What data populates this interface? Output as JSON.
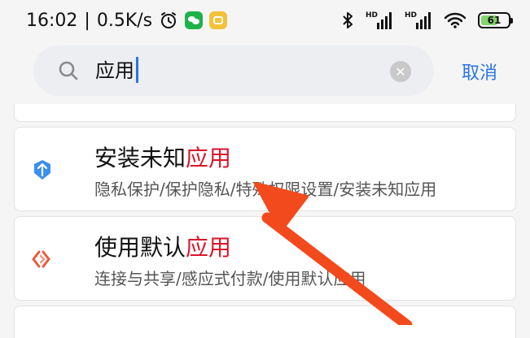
{
  "status_bar": {
    "time": "16:02",
    "separator": "|",
    "network_speed": "0.5K/s",
    "icons": [
      "alarm-icon",
      "wechat-icon",
      "note-app-icon",
      "bluetooth-icon",
      "hd-signal-icon",
      "hd-signal-icon",
      "wifi-icon",
      "battery-icon"
    ],
    "hd_label": "HD",
    "battery_level": "61"
  },
  "search": {
    "query": "应用",
    "cancel_label": "取消"
  },
  "results": [
    {
      "title_prefix": "安装未知",
      "title_highlight": "应用",
      "path": "隐私保护/保护隐私/特殊权限设置/安装未知应用",
      "icon": "shield-icon",
      "icon_color": "#3a8ff0"
    },
    {
      "title_prefix": "使用默认",
      "title_highlight": "应用",
      "path": "连接与共享/感应式付款/使用默认应用",
      "icon": "nfc-icon",
      "icon_color": "#ea5a3c"
    }
  ],
  "colors": {
    "accent": "#2a74e8",
    "highlight": "#d8162b",
    "annotation_arrow": "#f24a1c"
  }
}
